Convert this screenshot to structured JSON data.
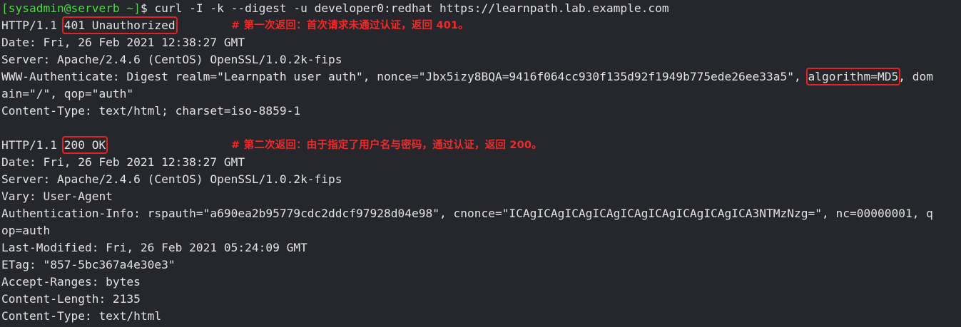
{
  "terminal": {
    "prompt": {
      "open": "[",
      "user": "sysadmin@serverb",
      "path": " ~",
      "close": "]",
      "symbol": "$ ",
      "command": "curl -I -k --digest -u developer0:redhat https://learnpath.lab.example.com"
    },
    "response1": {
      "status_prefix": "HTTP/1.1 ",
      "status_value": "401 Unauthorized",
      "annotation": "# 第一次返回：首次请求未通过认证，返回 401。",
      "date": "Date: Fri, 26 Feb 2021 12:38:27 GMT",
      "server": "Server: Apache/2.4.6 (CentOS) OpenSSL/1.0.2k-fips",
      "www_auth_prefix": "WWW-Authenticate: Digest realm=\"Learnpath user auth\", nonce=\"Jbx5izy8BQA=9416f064cc930f135d92f1949b775ede26ee33a5\", ",
      "www_auth_algorithm": "algorithm=MD5",
      "www_auth_suffix": ", dom",
      "www_auth_cont": "ain=\"/\", qop=\"auth\"",
      "content_type": "Content-Type: text/html; charset=iso-8859-1"
    },
    "response2": {
      "status_prefix": "HTTP/1.1 ",
      "status_value": "200 OK",
      "annotation": "# 第二次返回：由于指定了用户名与密码，通过认证，返回 200。",
      "date": "Date: Fri, 26 Feb 2021 12:38:27 GMT",
      "server": "Server: Apache/2.4.6 (CentOS) OpenSSL/1.0.2k-fips",
      "vary": "Vary: User-Agent",
      "auth_info": "Authentication-Info: rspauth=\"a690ea2b95779cdc2ddcf97928d04e98\", cnonce=\"ICAgICAgICAgICAgICAgICAgICAgICAgICA3NTMzNzg=\", nc=00000001, q",
      "auth_info_cont": "op=auth",
      "last_modified": "Last-Modified: Fri, 26 Feb 2021 05:24:09 GMT",
      "etag": "ETag: \"857-5bc367a4e30e3\"",
      "accept_ranges": "Accept-Ranges: bytes",
      "content_length": "Content-Length: 2135",
      "content_type": "Content-Type: text/html"
    }
  }
}
